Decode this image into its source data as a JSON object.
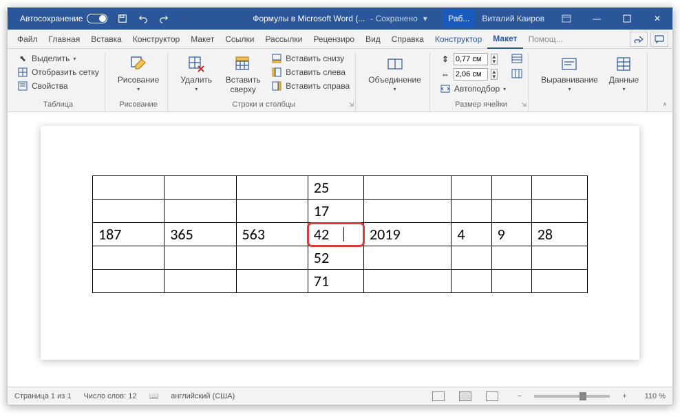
{
  "title": {
    "autosave": "Автосохранение",
    "docname": "Формулы в Microsoft Word (...",
    "saved": "- Сохранено",
    "tabShort": "Раб...",
    "user": "Виталий Каиров"
  },
  "menu": {
    "file": "Файл",
    "home": "Главная",
    "insert": "Вставка",
    "designCtx": "Конструктор",
    "layout": "Макет",
    "refs": "Ссылки",
    "mail": "Рассылки",
    "review": "Рецензиро",
    "view": "Вид",
    "help": "Справка",
    "tblDesign": "Конструктор",
    "tblLayout": "Макет",
    "tellme": "Помощ..."
  },
  "ribbon": {
    "g1": {
      "label": "Таблица",
      "select": "Выделить",
      "grid": "Отобразить сетку",
      "props": "Свойства"
    },
    "g2": {
      "label": "Рисование",
      "draw": "Рисование"
    },
    "g3": {
      "del": "Удалить",
      "ins": "Вставить сверху",
      "below": "Вставить снизу",
      "left": "Вставить слева",
      "right": "Вставить справа",
      "label": "Строки и столбцы"
    },
    "g4": {
      "merge": "Объединение",
      "label": ""
    },
    "g5": {
      "h": "0,77 см",
      "w": "2,06 см",
      "auto": "Автоподбор",
      "label": "Размер ячейки"
    },
    "g6": {
      "align": "Выравнивание",
      "data": "Данные"
    }
  },
  "chart_data": {
    "type": "table",
    "rows": 5,
    "cols": 8,
    "cells": {
      "r0c3": "25",
      "r1c3": "17",
      "r2c0": "187",
      "r2c1": "365",
      "r2c2": "563",
      "r2c3": "42",
      "r2c4": "2019",
      "r2c5": "4",
      "r2c6": "9",
      "r2c7": "28",
      "r3c3": "52",
      "r4c3": "71"
    },
    "highlighted": "r2c3"
  },
  "status": {
    "page": "Страница 1 из 1",
    "words": "Число слов: 12",
    "lang": "английский (США)",
    "zoom": "110 %"
  }
}
